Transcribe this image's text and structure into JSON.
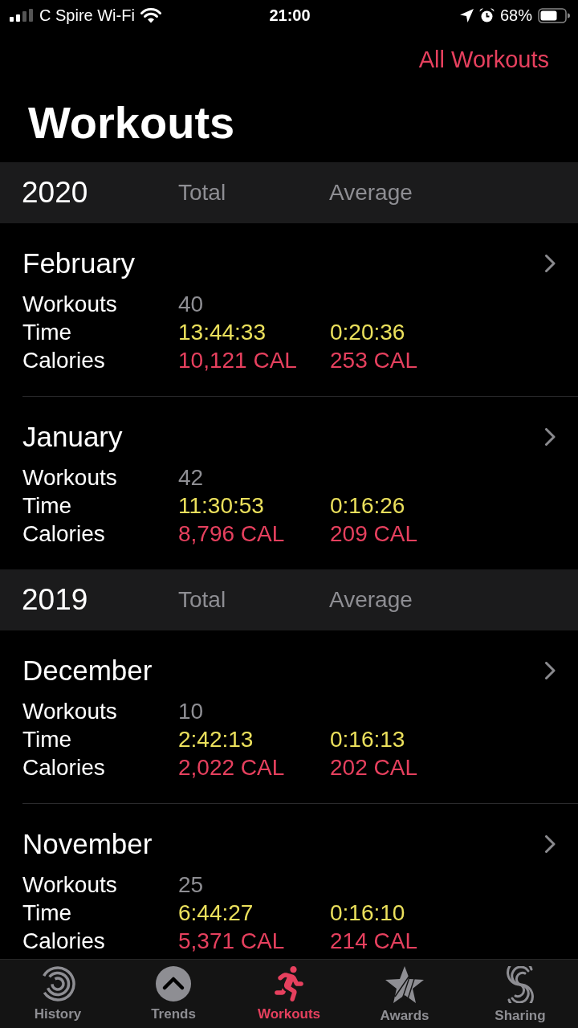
{
  "status_bar": {
    "carrier": "C Spire Wi-Fi",
    "time": "21:00",
    "battery": "68%"
  },
  "nav": {
    "action": "All Workouts"
  },
  "title": "Workouts",
  "years": [
    {
      "year": "2020",
      "total_heading": "Total",
      "average_heading": "Average",
      "months": [
        {
          "name": "February",
          "stats": [
            {
              "kind": "count",
              "label": "Workouts",
              "total": "40"
            },
            {
              "kind": "time",
              "label": "Time",
              "total": "13:44:33",
              "average": "0:20:36"
            },
            {
              "kind": "calories",
              "label": "Calories",
              "total": "10,121 CAL",
              "average": "253 CAL"
            }
          ]
        },
        {
          "name": "January",
          "stats": [
            {
              "kind": "count",
              "label": "Workouts",
              "total": "42"
            },
            {
              "kind": "time",
              "label": "Time",
              "total": "11:30:53",
              "average": "0:16:26"
            },
            {
              "kind": "calories",
              "label": "Calories",
              "total": "8,796 CAL",
              "average": "209 CAL"
            }
          ]
        }
      ]
    },
    {
      "year": "2019",
      "total_heading": "Total",
      "average_heading": "Average",
      "months": [
        {
          "name": "December",
          "stats": [
            {
              "kind": "count",
              "label": "Workouts",
              "total": "10"
            },
            {
              "kind": "time",
              "label": "Time",
              "total": "2:42:13",
              "average": "0:16:13"
            },
            {
              "kind": "calories",
              "label": "Calories",
              "total": "2,022 CAL",
              "average": "202 CAL"
            }
          ]
        },
        {
          "name": "November",
          "stats": [
            {
              "kind": "count",
              "label": "Workouts",
              "total": "25"
            },
            {
              "kind": "time",
              "label": "Time",
              "total": "6:44:27",
              "average": "0:16:10"
            },
            {
              "kind": "calories",
              "label": "Calories",
              "total": "5,371 CAL",
              "average": "214 CAL"
            }
          ]
        }
      ]
    }
  ],
  "tabs": [
    {
      "label": "History",
      "selected": false
    },
    {
      "label": "Trends",
      "selected": false
    },
    {
      "label": "Workouts",
      "selected": true
    },
    {
      "label": "Awards",
      "selected": false
    },
    {
      "label": "Sharing",
      "selected": false
    }
  ]
}
